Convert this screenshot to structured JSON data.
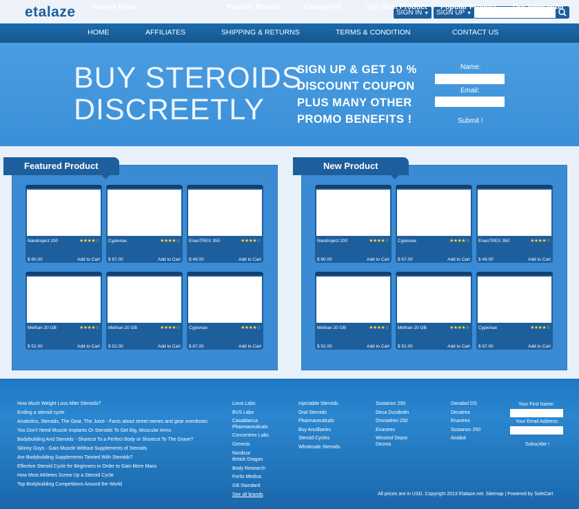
{
  "header": {
    "logo": "etalaze",
    "sign_in": "SIGN IN",
    "sign_up": "SIGN UP",
    "search_placeholder": ""
  },
  "nav": [
    "HOME",
    "AFFILIATES",
    "SHIPPING & RETURNS",
    "TERMS & CONDITION",
    "CONTACT US"
  ],
  "hero": {
    "headline_1": "BUY STEROIDS",
    "headline_2": "DISCREETLY",
    "promo_1": "SIGN UP & GET 10 %",
    "promo_2": "DISCOUNT COUPON",
    "promo_3": "PLUS MANY OTHER",
    "promo_4": "PROMO BENEFITS !",
    "name_label": "Name:",
    "email_label": "Email:",
    "submit": "Submit !"
  },
  "featured": {
    "title": "Featured Product",
    "products": [
      {
        "name": "Nandroject 200",
        "stars": "★★★★☆",
        "price": "$ 60.00",
        "cart": "Add to Cart"
      },
      {
        "name": "Cypionax",
        "stars": "★★★★☆",
        "price": "$ 67.00",
        "cart": "Add to Cart"
      },
      {
        "name": "EnanTREX 350",
        "stars": "★★★★☆",
        "price": "$ 49.00",
        "cart": "Add to Cart"
      },
      {
        "name": "Methan 20 GB",
        "stars": "★★★★☆",
        "price": "$ 52.00",
        "cart": "Add to Cart"
      },
      {
        "name": "Methan 20 GB",
        "stars": "★★★★☆",
        "price": "$ 52.00",
        "cart": "Add to Cart"
      },
      {
        "name": "Cypionax",
        "stars": "★★★★☆",
        "price": "$ 67.00",
        "cart": "Add to Cart"
      }
    ]
  },
  "new": {
    "title": "New Product",
    "products": [
      {
        "name": "Nandroject 200",
        "stars": "★★★★☆",
        "price": "$ 60.00",
        "cart": "Add to Cart"
      },
      {
        "name": "Cypionax",
        "stars": "★★★★☆",
        "price": "$ 67.00",
        "cart": "Add to Cart"
      },
      {
        "name": "EnanTREX 350",
        "stars": "★★★★☆",
        "price": "$ 49.00",
        "cart": "Add to Cart"
      },
      {
        "name": "Methan 20 GB",
        "stars": "★★★★☆",
        "price": "$ 52.00",
        "cart": "Add to Cart"
      },
      {
        "name": "Methan 20 GB",
        "stars": "★★★★☆",
        "price": "$ 52.00",
        "cart": "Add to Cart"
      },
      {
        "name": "Cypionax",
        "stars": "★★★★☆",
        "price": "$ 67.00",
        "cart": "Add to Cart"
      }
    ]
  },
  "footer": {
    "news_title": "Recent News",
    "news": [
      "How Much Weight Loss After Steroids?",
      "Ending a steroid cycle",
      "Anabolics, Steroids, The Gear, The Juice - Facts about street names and gear overdoses",
      "You Don't Need Muscle Implants Or Steroids To Get Big, Muscular Arms",
      "Bodybuilding And Steroids - Shortcut To a Perfect Body or Shortcut To The Grave?",
      "Skinny Guys - Gain Muscle Without Supplements of Steroids",
      "Are Bodybuilding Supplements Tainted With Steroids?",
      "Effective Steroid Cycle for Beginners in Order to Gain More Mass",
      "How Most Athletes Screw Up a Steroid Cycle",
      "Top Bodybuilding Competitions Around the World"
    ],
    "brands_title": "Popular Brands",
    "brands": [
      "Lixus Labs",
      "BVS Labs",
      "Casablanca",
      "Pharmaceuticals",
      "Concentrex Labs",
      "Genesis",
      "Nordicor",
      "British Dragon",
      "Body Research",
      "Fortis Medica",
      "GB Standard"
    ],
    "brands_all": "See all brands",
    "categories_title": "Categories",
    "categories": [
      "Injectable Steroids",
      "Oral Steroids",
      "Pharmaceuticals",
      "Buy Ancilliaries",
      "Steroid Cycles",
      "Wholesale Steroids"
    ],
    "top_title": "Top Most Product",
    "top": [
      "Sustanon 250",
      "Deca Durabolin",
      "Omnadren 250",
      "Enantrex",
      "Winstrol Depot",
      "Desma"
    ],
    "popular_title": "Popular Product",
    "popular": [
      "Danabol DS",
      "Decatrex",
      "Enantrex",
      "Sustanon 250",
      "Anabol"
    ],
    "newsletter_title": "Our Newsletter",
    "nl_first": "Your First Name:",
    "nl_email": "Your Email Address:",
    "nl_subscribe": "Subscribe !",
    "copyright": "All prices are in USD. Copyright 2013 Etalaze.net. Sitemap | Powered by SoleCart"
  }
}
